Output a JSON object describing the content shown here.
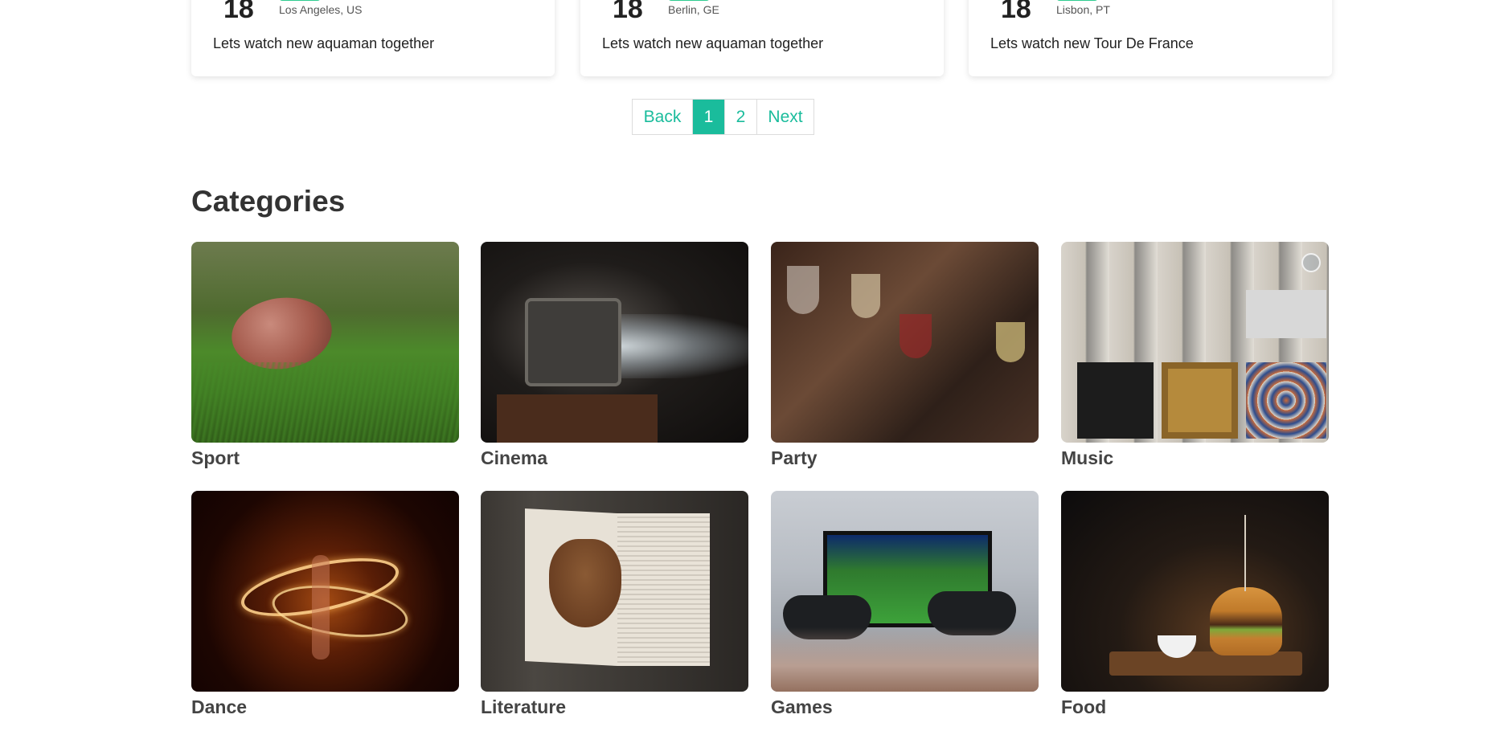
{
  "events": [
    {
      "day": "18",
      "location": "Los Angeles, US",
      "title": "Lets watch new aquaman together"
    },
    {
      "day": "18",
      "location": "Berlin, GE",
      "title": "Lets watch new aquaman together"
    },
    {
      "day": "18",
      "location": "Lisbon, PT",
      "title": "Lets watch new Tour De France"
    }
  ],
  "pagination": {
    "back": "Back",
    "page1": "1",
    "page2": "2",
    "next": "Next"
  },
  "categories": {
    "title": "Categories",
    "items": [
      {
        "label": "Sport"
      },
      {
        "label": "Cinema"
      },
      {
        "label": "Party"
      },
      {
        "label": "Music"
      },
      {
        "label": "Dance"
      },
      {
        "label": "Literature"
      },
      {
        "label": "Games"
      },
      {
        "label": "Food"
      }
    ]
  },
  "colors": {
    "accent": "#1abc9c",
    "tag": "#2ecc8f"
  }
}
